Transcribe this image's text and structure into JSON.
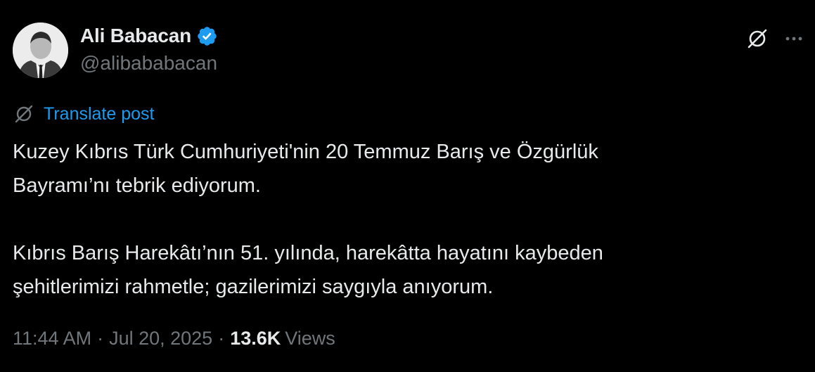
{
  "author": {
    "name": "Ali Babacan",
    "handle": "@alibababacan",
    "verified": true,
    "verified_color": "#1d9bf0"
  },
  "header_actions": {
    "grok_icon": "grok-icon",
    "more_icon": "more-icon"
  },
  "translate": {
    "label": "Translate post",
    "icon": "translate-icon",
    "color": "#1d9bf0"
  },
  "post": {
    "paragraphs": [
      [
        "Kuzey Kıbrıs Türk Cumhuriyeti'nin 20 Temmuz Barış ve Özgürlük",
        "Bayramı’nı tebrik ediyorum."
      ],
      [
        "Kıbrıs Barış Harekâtı’nın 51. yılında, harekâtta hayatını kaybeden",
        "şehitlerimizi rahmetle; gazilerimizi saygıyla anıyorum."
      ]
    ]
  },
  "meta": {
    "time": "11:44 AM",
    "separator": "·",
    "date": "Jul 20, 2025",
    "views_count": "13.6K",
    "views_label": "Views"
  },
  "colors": {
    "background": "#000000",
    "text_primary": "#e7e9ea",
    "text_secondary": "#71767b",
    "accent": "#1d9bf0"
  }
}
